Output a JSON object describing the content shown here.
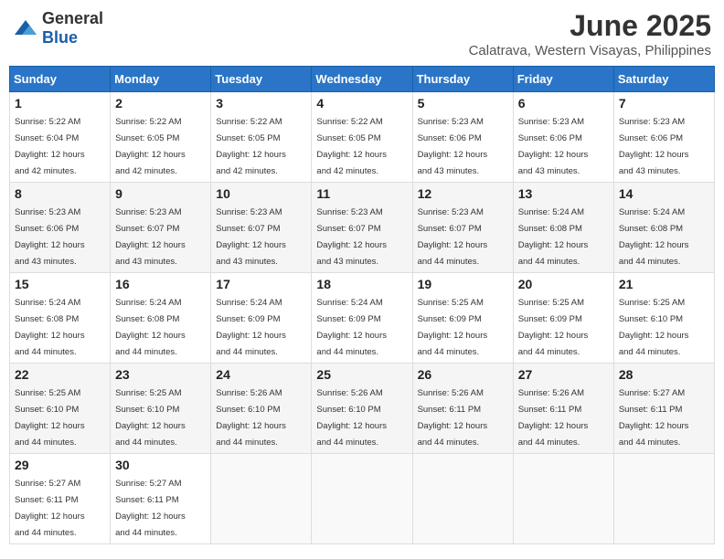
{
  "logo": {
    "general": "General",
    "blue": "Blue"
  },
  "title": {
    "month": "June 2025",
    "location": "Calatrava, Western Visayas, Philippines"
  },
  "weekdays": [
    "Sunday",
    "Monday",
    "Tuesday",
    "Wednesday",
    "Thursday",
    "Friday",
    "Saturday"
  ],
  "weeks": [
    [
      {
        "day": "1",
        "sunrise": "5:22 AM",
        "sunset": "6:04 PM",
        "daylight": "12 hours and 42 minutes."
      },
      {
        "day": "2",
        "sunrise": "5:22 AM",
        "sunset": "6:05 PM",
        "daylight": "12 hours and 42 minutes."
      },
      {
        "day": "3",
        "sunrise": "5:22 AM",
        "sunset": "6:05 PM",
        "daylight": "12 hours and 42 minutes."
      },
      {
        "day": "4",
        "sunrise": "5:22 AM",
        "sunset": "6:05 PM",
        "daylight": "12 hours and 42 minutes."
      },
      {
        "day": "5",
        "sunrise": "5:23 AM",
        "sunset": "6:06 PM",
        "daylight": "12 hours and 43 minutes."
      },
      {
        "day": "6",
        "sunrise": "5:23 AM",
        "sunset": "6:06 PM",
        "daylight": "12 hours and 43 minutes."
      },
      {
        "day": "7",
        "sunrise": "5:23 AM",
        "sunset": "6:06 PM",
        "daylight": "12 hours and 43 minutes."
      }
    ],
    [
      {
        "day": "8",
        "sunrise": "5:23 AM",
        "sunset": "6:06 PM",
        "daylight": "12 hours and 43 minutes."
      },
      {
        "day": "9",
        "sunrise": "5:23 AM",
        "sunset": "6:07 PM",
        "daylight": "12 hours and 43 minutes."
      },
      {
        "day": "10",
        "sunrise": "5:23 AM",
        "sunset": "6:07 PM",
        "daylight": "12 hours and 43 minutes."
      },
      {
        "day": "11",
        "sunrise": "5:23 AM",
        "sunset": "6:07 PM",
        "daylight": "12 hours and 43 minutes."
      },
      {
        "day": "12",
        "sunrise": "5:23 AM",
        "sunset": "6:07 PM",
        "daylight": "12 hours and 44 minutes."
      },
      {
        "day": "13",
        "sunrise": "5:24 AM",
        "sunset": "6:08 PM",
        "daylight": "12 hours and 44 minutes."
      },
      {
        "day": "14",
        "sunrise": "5:24 AM",
        "sunset": "6:08 PM",
        "daylight": "12 hours and 44 minutes."
      }
    ],
    [
      {
        "day": "15",
        "sunrise": "5:24 AM",
        "sunset": "6:08 PM",
        "daylight": "12 hours and 44 minutes."
      },
      {
        "day": "16",
        "sunrise": "5:24 AM",
        "sunset": "6:08 PM",
        "daylight": "12 hours and 44 minutes."
      },
      {
        "day": "17",
        "sunrise": "5:24 AM",
        "sunset": "6:09 PM",
        "daylight": "12 hours and 44 minutes."
      },
      {
        "day": "18",
        "sunrise": "5:24 AM",
        "sunset": "6:09 PM",
        "daylight": "12 hours and 44 minutes."
      },
      {
        "day": "19",
        "sunrise": "5:25 AM",
        "sunset": "6:09 PM",
        "daylight": "12 hours and 44 minutes."
      },
      {
        "day": "20",
        "sunrise": "5:25 AM",
        "sunset": "6:09 PM",
        "daylight": "12 hours and 44 minutes."
      },
      {
        "day": "21",
        "sunrise": "5:25 AM",
        "sunset": "6:10 PM",
        "daylight": "12 hours and 44 minutes."
      }
    ],
    [
      {
        "day": "22",
        "sunrise": "5:25 AM",
        "sunset": "6:10 PM",
        "daylight": "12 hours and 44 minutes."
      },
      {
        "day": "23",
        "sunrise": "5:25 AM",
        "sunset": "6:10 PM",
        "daylight": "12 hours and 44 minutes."
      },
      {
        "day": "24",
        "sunrise": "5:26 AM",
        "sunset": "6:10 PM",
        "daylight": "12 hours and 44 minutes."
      },
      {
        "day": "25",
        "sunrise": "5:26 AM",
        "sunset": "6:10 PM",
        "daylight": "12 hours and 44 minutes."
      },
      {
        "day": "26",
        "sunrise": "5:26 AM",
        "sunset": "6:11 PM",
        "daylight": "12 hours and 44 minutes."
      },
      {
        "day": "27",
        "sunrise": "5:26 AM",
        "sunset": "6:11 PM",
        "daylight": "12 hours and 44 minutes."
      },
      {
        "day": "28",
        "sunrise": "5:27 AM",
        "sunset": "6:11 PM",
        "daylight": "12 hours and 44 minutes."
      }
    ],
    [
      {
        "day": "29",
        "sunrise": "5:27 AM",
        "sunset": "6:11 PM",
        "daylight": "12 hours and 44 minutes."
      },
      {
        "day": "30",
        "sunrise": "5:27 AM",
        "sunset": "6:11 PM",
        "daylight": "12 hours and 44 minutes."
      },
      null,
      null,
      null,
      null,
      null
    ]
  ],
  "labels": {
    "sunrise": "Sunrise:",
    "sunset": "Sunset:",
    "daylight": "Daylight:"
  }
}
